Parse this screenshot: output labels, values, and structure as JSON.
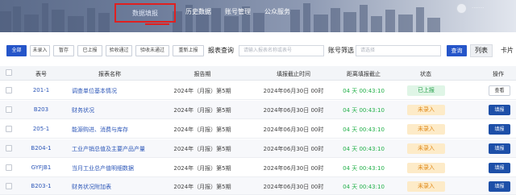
{
  "nav": {
    "items": [
      {
        "label": "数据填报",
        "active": true
      },
      {
        "label": "历史数据",
        "active": false
      },
      {
        "label": "账号管理",
        "active": false
      },
      {
        "label": "公众服务",
        "active": false
      }
    ],
    "user": "·······",
    "accent": "#e02020"
  },
  "toolbar": {
    "filters": [
      {
        "label": "全部",
        "active": true
      },
      {
        "label": "未录入",
        "active": false
      },
      {
        "label": "暂存",
        "active": false
      },
      {
        "label": "已上报",
        "active": false
      },
      {
        "label": "验收通过",
        "active": false
      },
      {
        "label": "验收未通过",
        "active": false
      },
      {
        "label": "重新上报",
        "active": false
      }
    ],
    "report_query_label": "报表查询",
    "report_query_placeholder": "请输入报表名称或表号",
    "account_filter_label": "账号筛选",
    "account_filter_placeholder": "请选择",
    "query_button": "查询",
    "view_list": "列表",
    "view_card": "卡片"
  },
  "table": {
    "headers": {
      "code": "表号",
      "name": "报表名称",
      "period": "报告期",
      "deadline": "填报截止时间",
      "remaining": "距离填报截止",
      "status": "状态",
      "action": "操作"
    },
    "rows": [
      {
        "code": "201-1",
        "name": "调查单位基本情况",
        "period": "2024年（月报）第5期",
        "deadline": "2024年06月30日 00时",
        "remaining": "04 天 00:43:10",
        "status": "已上报",
        "status_kind": "done",
        "action": "查看",
        "action_kind": "view"
      },
      {
        "code": "B203",
        "name": "财务状况",
        "period": "2024年（月报）第5期",
        "deadline": "2024年06月30日 00时",
        "remaining": "04 天 00:43:10",
        "status": "未录入",
        "status_kind": "pending",
        "action": "填报",
        "action_kind": "fill"
      },
      {
        "code": "205-1",
        "name": "能源购进、消费与库存",
        "period": "2024年（月报）第5期",
        "deadline": "2024年06月30日 00时",
        "remaining": "04 天 00:43:10",
        "status": "未录入",
        "status_kind": "pending",
        "action": "填报",
        "action_kind": "fill"
      },
      {
        "code": "B204-1",
        "name": "工业产销总值及主要产品产量",
        "period": "2024年（月报）第5期",
        "deadline": "2024年06月30日 00时",
        "remaining": "04 天 00:43:10",
        "status": "未录入",
        "status_kind": "pending",
        "action": "填报",
        "action_kind": "fill"
      },
      {
        "code": "GYFJB1",
        "name": "当月工业总产值明细数据",
        "period": "2024年（月报）第5期",
        "deadline": "2024年06月30日 00时",
        "remaining": "04 天 00:43:10",
        "status": "未录入",
        "status_kind": "pending",
        "action": "填报",
        "action_kind": "fill"
      },
      {
        "code": "B203-1",
        "name": "财务状况附加表",
        "period": "2024年（月报）第5期",
        "deadline": "2024年06月30日 00时",
        "remaining": "04 天 00:43:10",
        "status": "未录入",
        "status_kind": "pending",
        "action": "填报",
        "action_kind": "fill"
      }
    ]
  },
  "colors": {
    "primary": "#2555c9",
    "link": "#2d57b8",
    "countdown": "#23b04a",
    "status_done_text": "#27a04b",
    "status_pending_text": "#e08a1a",
    "action_fill": "#1d4fa8"
  }
}
